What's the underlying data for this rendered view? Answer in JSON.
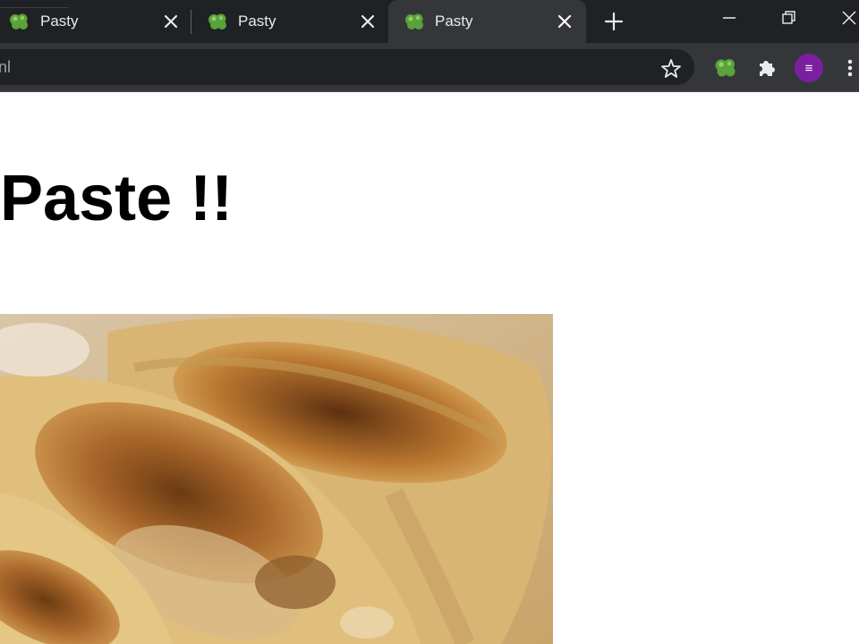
{
  "tabs": [
    {
      "title": "Pasty",
      "active": false
    },
    {
      "title": "Pasty",
      "active": false
    },
    {
      "title": "Pasty",
      "active": true
    }
  ],
  "toolbar": {
    "url_fragment": "nl",
    "avatar_initial": "≡"
  },
  "page": {
    "heading": "Paste !!",
    "image": {
      "subject": "pan-fried dumplings",
      "icon": "dumpling-photo"
    }
  },
  "colors": {
    "tabstrip_bg": "#202124",
    "toolbar_bg": "#35363a",
    "avatar_bg": "#7b1fa2",
    "favicon_green": "#5aa23a"
  }
}
